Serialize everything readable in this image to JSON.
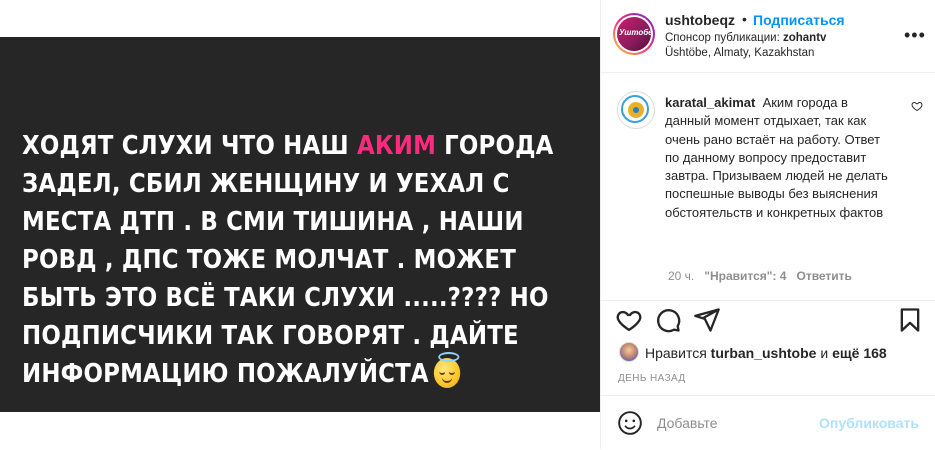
{
  "media": {
    "line1_pre": "ХОДЯТ СЛУХИ ЧТО НАШ ",
    "line1_hl": "АКИМ",
    "line1_post": " ГОРОДА",
    "line2": "ЗАДЕЛ, СБИЛ ЖЕНЩИНУ И УЕХАЛ С",
    "line3": "МЕСТА ДТП . В СМИ ТИШИНА , НАШИ",
    "line4": "РОВД , ДПС ТОЖЕ МОЛЧАТ . МОЖЕТ",
    "line5": "БЫТЬ ЭТО ВСЁ ТАКИ СЛУХИ .....???? НО",
    "line6": "ПОДПИСЧИКИ ТАК ГОВОРЯТ . ДАЙТЕ",
    "line7": "ИНФОРМАЦИЮ ПОЖАЛУЙСТА",
    "emoji": "smiling-face-with-halo",
    "highlight_color": "#ff2a7d"
  },
  "header": {
    "username": "ushtobeqz",
    "dot": "•",
    "follow": "Подписаться",
    "sponsor_label": "Спонсор публикации: ",
    "sponsor_name": "zohantv",
    "location": "Üshtöbe, Almaty, Kazakhstan",
    "avatar_text": "Уштобе",
    "more": "•••"
  },
  "comment": {
    "username": "karatal_akimat",
    "text": "Аким города в данный момент отдыхает, так как очень рано встаёт на работу. Ответ по данному вопросу предоставит завтра. Призываем людей не делать поспешные выводы без выяснения обстоятельств и конкретных фактов",
    "time": "20 ч.",
    "likes": "\"Нравится\": 4",
    "reply": "Ответить"
  },
  "likes": {
    "prefix": "Нравится ",
    "user": "turban_ushtobe",
    "middle": " и ",
    "count": "ещё 168"
  },
  "date": "ДЕНЬ НАЗАД",
  "add_comment": {
    "placeholder": "Добавьте",
    "post": "Опубликовать"
  },
  "colors": {
    "link_blue": "#0095f6",
    "disabled_blue": "#b2dffc",
    "media_bg": "#262626"
  }
}
